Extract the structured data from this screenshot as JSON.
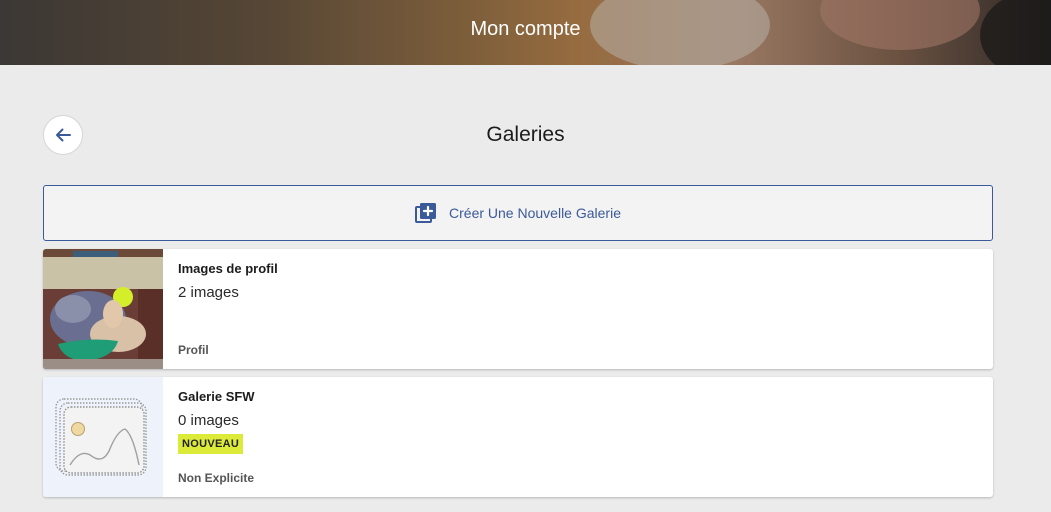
{
  "header": {
    "title": "Mon compte"
  },
  "page": {
    "title": "Galeries"
  },
  "create_button": {
    "label": "Créer Une Nouvelle Galerie",
    "icon": "add-to-gallery-icon",
    "color": "#3b5a9a"
  },
  "galleries": [
    {
      "name": "Images de profil",
      "count": "2 images",
      "badge": "",
      "tag": "Profil",
      "thumbnail": "photo"
    },
    {
      "name": "Galerie SFW",
      "count": "0 images",
      "badge": "NOUVEAU",
      "tag": "Non Explicite",
      "thumbnail": "placeholder-image-icon"
    }
  ],
  "colors": {
    "background": "#ebebeb",
    "badge": "#dceb3a",
    "accent": "#3b5a9a"
  }
}
